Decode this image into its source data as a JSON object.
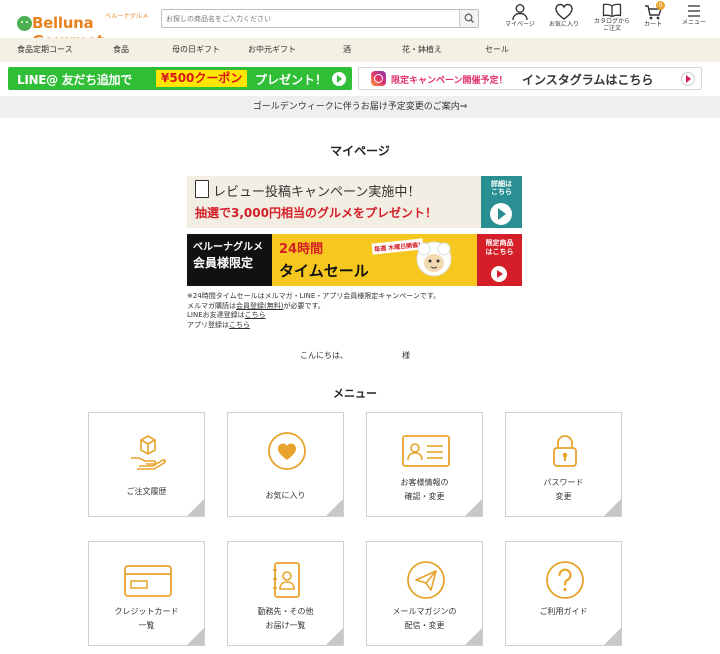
{
  "header": {
    "logo_text": "Belluna Gourmet",
    "logo_sub": "ベルーナグルメ",
    "search_placeholder": "お探しの商品名をご入力ください",
    "nav": [
      {
        "label": "マイページ",
        "icon": "person-icon"
      },
      {
        "label": "お気に入り",
        "icon": "heart-icon"
      },
      {
        "label": "カタログから\nご注文",
        "icon": "book-icon"
      },
      {
        "label": "カート",
        "icon": "cart-icon",
        "badge": "0"
      },
      {
        "label": "メニュー",
        "icon": "hamburger-icon"
      }
    ]
  },
  "categories": [
    "食品定期コース",
    "食品",
    "母の日ギフト",
    "お中元ギフト",
    "酒",
    "花・鉢植え",
    "セール"
  ],
  "banners": {
    "line": {
      "text1": "LINE@ 友だち追加で",
      "coupon": "¥500クーポン",
      "text2": "プレゼント！"
    },
    "instagram": {
      "tag": "限定キャンペーン開催予定！",
      "main": "インスタグラムはこちら"
    }
  },
  "notice": "ゴールデンウィークに伴うお届け予定変更のご案内⇒",
  "page_title": "マイページ",
  "review_banner": {
    "line1": "レビュー投稿キャンペーン実施中！",
    "line2": "抽選で3,000円相当のグルメをプレゼント！",
    "side": "詳細は\nこちら"
  },
  "sale_banner": {
    "left1": "ベルーナグルメ",
    "left2": "会員様限定",
    "mid1": "24時間",
    "mid2": "タイムセール",
    "thursday": "毎週 木曜日開催!",
    "side": "限定商品\nはこちら"
  },
  "notes": {
    "line1": "※24時間タイムセールはメルマガ・LINE・アプリ会員様限定キャンペーンです。",
    "line2_pre": "メルマガ購読は",
    "line2_link": "会員登録(無料)",
    "line2_post": "が必要です。",
    "line3_pre": "LINEお友達登録は",
    "line3_link": "こちら",
    "line4_pre": "アプリ登録は",
    "line4_link": "こちら"
  },
  "greeting": {
    "hello": "こんにちは、",
    "sama": "様"
  },
  "menu_title": "メニュー",
  "menu": [
    {
      "label": "ご注文履歴",
      "icon": "order-history-icon"
    },
    {
      "label": "お気に入り",
      "icon": "favorite-icon"
    },
    {
      "label": "お客様情報の\n確認・変更",
      "icon": "id-card-icon"
    },
    {
      "label": "パスワード\n変更",
      "icon": "lock-icon"
    },
    {
      "label": "クレジットカード\n一覧",
      "icon": "credit-card-icon"
    },
    {
      "label": "勤務先・その他\nお届け一覧",
      "icon": "address-book-icon"
    },
    {
      "label": "メールマガジンの\n配信・変更",
      "icon": "paper-plane-icon"
    },
    {
      "label": "ご利用ガイド",
      "icon": "help-icon"
    }
  ],
  "colors": {
    "accent": "#e7a32b",
    "line_green": "#2fbe35",
    "sale_red": "#d41e28",
    "review_teal": "#2a8f92"
  }
}
